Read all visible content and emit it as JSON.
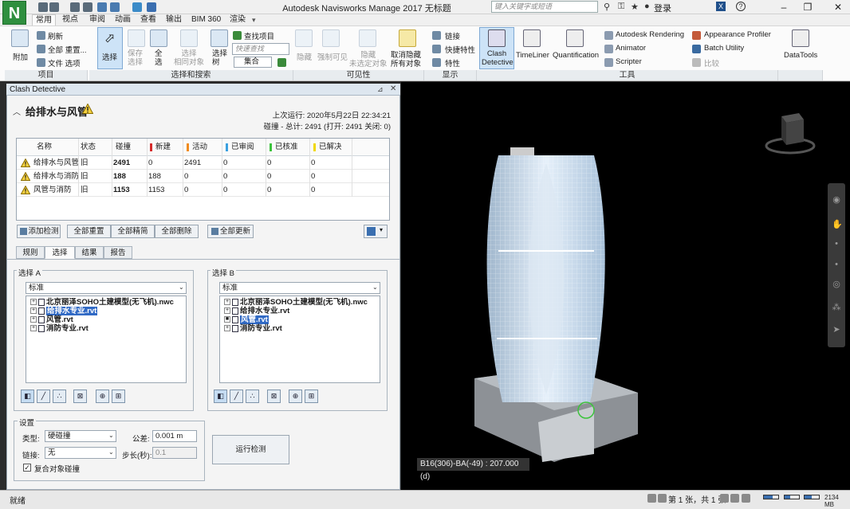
{
  "window": {
    "title": "Autodesk Navisworks Manage 2017   无标题",
    "search_placeholder": "键入关键字或短语",
    "signin": "登录",
    "logo_letter": "N"
  },
  "ribbon_tabs": [
    "常用",
    "视点",
    "审阅",
    "动画",
    "查看",
    "输出",
    "BIM 360",
    "渲染"
  ],
  "ribbon": {
    "project": {
      "append": "附加",
      "refresh": "刷新",
      "reset_all": "全部 重置...",
      "file_options": "文件 选项",
      "group": "项目"
    },
    "select_search": {
      "select": "选择",
      "save_selection": "保存\n选择",
      "select_all": "全\n选",
      "select_same": "选择\n相同对象",
      "selection_tree": "选择\n树",
      "find_items": "查找项目",
      "quick_find": "快速查找",
      "sets": "集合",
      "group": "选择和搜索"
    },
    "visibility": {
      "hide": "隐藏",
      "require": "强制可见",
      "hide_unselected": "隐藏\n未选定对象",
      "unhide_all": "取消隐藏\n所有对象",
      "group": "可见性"
    },
    "display": {
      "links": "链接",
      "quick_properties": "快捷特性",
      "properties": "特性",
      "group": "显示"
    },
    "tools": {
      "clash_detective": "Clash\nDetective",
      "timeliner": "TimeLiner",
      "quantification": "Quantification",
      "autodesk_rendering": "Autodesk Rendering",
      "animator": "Animator",
      "scripter": "Scripter",
      "appearance_profiler": "Appearance Profiler",
      "batch_utility": "Batch Utility",
      "compare": "比较",
      "datatools": "DataTools",
      "group": "工具"
    }
  },
  "clash_panel": {
    "header": "Clash Detective",
    "test_title": "给排水与风管",
    "last_run": "上次运行:  2020年5月22日 22:34:21",
    "summary": "碰撞 - 总计:  2491  (打开:  2491  关闭:  0)",
    "columns": [
      "名称",
      "状态",
      "碰撞",
      "新建",
      "活动",
      "已审阅",
      "已核准",
      "已解决"
    ],
    "column_colors": {
      "新建": "#d62b2b",
      "活动": "#f08c1e",
      "已审阅": "#3aa0e0",
      "已核准": "#3cc33c",
      "已解决": "#f0d800"
    },
    "tests": [
      {
        "name": "给排水与风管",
        "status": "旧",
        "clashes": "2491",
        "new": "0",
        "active": "2491",
        "reviewed": "0",
        "approved": "0",
        "resolved": "0"
      },
      {
        "name": "给排水与消防",
        "status": "旧",
        "clashes": "188",
        "new": "188",
        "active": "0",
        "reviewed": "0",
        "approved": "0",
        "resolved": "0"
      },
      {
        "name": "风管与消防",
        "status": "旧",
        "clashes": "1153",
        "new": "1153",
        "active": "0",
        "reviewed": "0",
        "approved": "0",
        "resolved": "0"
      }
    ],
    "buttons": {
      "add_test": "添加检测",
      "reset_all": "全部重置",
      "compact_all": "全部精简",
      "delete_all": "全部删除",
      "update_all": "全部更新",
      "run_test": "运行检测"
    },
    "subtabs": [
      "规则",
      "选择",
      "结果",
      "报告"
    ],
    "active_subtab": "选择",
    "selection_a": {
      "caption": "选择 A",
      "mode": "标准",
      "tree": [
        {
          "label": "北京丽泽SOHO土建模型(无飞机).nwc",
          "highlighted": false,
          "expander": "+"
        },
        {
          "label": "给排水专业.rvt",
          "highlighted": true,
          "expander": "+"
        },
        {
          "label": "风管.rvt",
          "highlighted": false,
          "expander": "+"
        },
        {
          "label": "消防专业.rvt",
          "highlighted": false,
          "expander": "+"
        }
      ]
    },
    "selection_b": {
      "caption": "选择 B",
      "mode": "标准",
      "tree": [
        {
          "label": "北京丽泽SOHO土建模型(无飞机).nwc",
          "highlighted": false,
          "expander": "+"
        },
        {
          "label": "给排水专业.rvt",
          "highlighted": false,
          "expander": "+"
        },
        {
          "label": "风管.rvt",
          "highlighted": true,
          "expander": "■"
        },
        {
          "label": "消防专业.rvt",
          "highlighted": false,
          "expander": "+"
        }
      ]
    },
    "settings": {
      "caption": "设置",
      "type_label": "类型:",
      "type_value": "硬碰撞",
      "tolerance_label": "公差:",
      "tolerance_value": "0.001 m",
      "link_label": "链接:",
      "link_value": "无",
      "step_label": "步长(秒):",
      "step_value": "0.1",
      "composite_label": "复合对象碰撞",
      "composite_checked": true
    }
  },
  "viewport": {
    "coord_readout": "B16(306)-BA(-49) : 207.000 (d)"
  },
  "statusbar": {
    "status": "就绪",
    "page": "第 1 张，共 1 张",
    "mem_left": "2134",
    "mem_right": "MB"
  }
}
